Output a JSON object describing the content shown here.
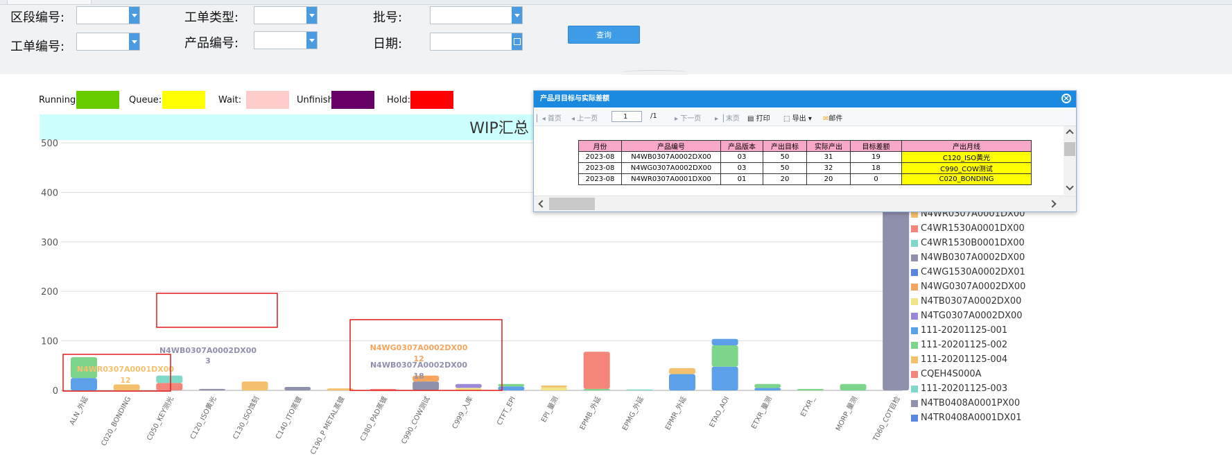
{
  "filters": {
    "section_no": {
      "label": "区段编号:",
      "value": ""
    },
    "order_type": {
      "label": "工单类型:",
      "value": ""
    },
    "batch_no": {
      "label": "批号:",
      "value": ""
    },
    "order_no": {
      "label": "工单编号:",
      "value": ""
    },
    "product_no": {
      "label": "产品编号:",
      "value": ""
    },
    "date": {
      "label": "日期:",
      "value": ""
    },
    "query_label": "查询"
  },
  "status_legend": [
    {
      "label": "Running:",
      "color": "#66cc00"
    },
    {
      "label": "Queue:",
      "color": "#ffff00"
    },
    {
      "label": "Wait:",
      "color": "#ffcccc"
    },
    {
      "label": "Unfinish:",
      "color": "#660066"
    },
    {
      "label": "Hold:",
      "color": "#ff0000"
    }
  ],
  "chart_data": {
    "type": "bar",
    "title": "WIP汇总",
    "ylim": [
      0,
      500
    ],
    "yticks": [
      0,
      100,
      200,
      300,
      400,
      500
    ],
    "grid": true,
    "legend_position": "right",
    "categories": [
      "ALN_外延",
      "C020_BONDING",
      "C050_KEY测光",
      "C120_ISO黄光",
      "C130_ISO蚀刻",
      "C140_ITO蒸镀",
      "C190_P METAL蒸镀",
      "C380_PAD蒸镀",
      "C990_COW测试",
      "C999_入库",
      "CTFT_EPI",
      "EPI_量测",
      "EPMB_外延",
      "EPMG_外延",
      "EPMR_外延",
      "ETAO_AOI",
      "ETXR_量测",
      "ETXR_",
      "MORP_量测",
      "T060_COT目检"
    ],
    "stacks": [
      [
        {
          "color": "#5ba0e8",
          "value": 25
        },
        {
          "color": "#7cd58a",
          "value": 42
        }
      ],
      [
        {
          "color": "#f5c06d",
          "value": 12
        }
      ],
      [
        {
          "color": "#f4857a",
          "value": 15
        },
        {
          "color": "#7ed9c9",
          "value": 15
        }
      ],
      [
        {
          "color": "#8f90ac",
          "value": 3
        }
      ],
      [
        {
          "color": "#f5c06d",
          "value": 18
        }
      ],
      [
        {
          "color": "#8f90ac",
          "value": 7
        }
      ],
      [
        {
          "color": "#f5c06d",
          "value": 4
        }
      ],
      [
        {
          "color": "#f4857a",
          "value": 3
        }
      ],
      [
        {
          "color": "#8f90ac",
          "value": 18
        },
        {
          "color": "#f5a55e",
          "value": 12
        }
      ],
      [
        {
          "color": "#f2e48a",
          "value": 5
        },
        {
          "color": "#9b88d8",
          "value": 8
        }
      ],
      [
        {
          "color": "#5ba0e8",
          "value": 8
        },
        {
          "color": "#7cd58a",
          "value": 5
        }
      ],
      [
        {
          "color": "#f2e48a",
          "value": 6
        },
        {
          "color": "#f5c06d",
          "value": 4
        }
      ],
      [
        {
          "color": "#7cd58a",
          "value": 3
        },
        {
          "color": "#f4857a",
          "value": 75
        }
      ],
      [
        {
          "color": "#7ed9c9",
          "value": 2
        }
      ],
      [
        {
          "color": "#5ba0e8",
          "value": 33
        },
        {
          "color": "#f5c06d",
          "value": 12
        }
      ],
      [
        {
          "color": "#5ba0e8",
          "value": 48
        },
        {
          "color": "#7cd58a",
          "value": 43
        },
        {
          "color": "#5ba0e8",
          "value": 13
        }
      ],
      [
        {
          "color": "#5ba0e8",
          "value": 5
        },
        {
          "color": "#7cd58a",
          "value": 8
        }
      ],
      [
        {
          "color": "#7cd58a",
          "value": 3
        }
      ],
      [
        {
          "color": "#7cd58a",
          "value": 13
        }
      ],
      [
        {
          "color": "#8f90ac",
          "value": 430
        }
      ]
    ],
    "annotations": [
      {
        "text": "N4WR0307A0001DX00",
        "value_text": "12",
        "color": "#f5c06d"
      },
      {
        "text": "N4WB0307A0002DX00",
        "value_text": "3",
        "color": "#8f90ac"
      },
      {
        "text": "N4WG0307A0002DX00",
        "value_text": "12",
        "color": "#f5a55e"
      },
      {
        "text": "N4WB0307A0002DX00",
        "value_text": "18",
        "color": "#8f90ac"
      }
    ],
    "series_legend": [
      {
        "name": "N4WR0307A0001DX00",
        "color": "#f5c06d"
      },
      {
        "name": "C4WR1530A0001DX00",
        "color": "#f4857a"
      },
      {
        "name": "C4WR1530B0001DX00",
        "color": "#7ed9c9"
      },
      {
        "name": "N4WB0307A0002DX00",
        "color": "#8f90ac"
      },
      {
        "name": "C4WG1530A0002DX01",
        "color": "#5b86e0"
      },
      {
        "name": "N4WG0307A0002DX00",
        "color": "#f5a55e"
      },
      {
        "name": "N4TB0307A0002DX00",
        "color": "#f2e48a"
      },
      {
        "name": "N4TG0307A0002DX00",
        "color": "#9b88d8"
      },
      {
        "name": "111-20201125-001",
        "color": "#5ba0e8"
      },
      {
        "name": "111-20201125-002",
        "color": "#7cd58a"
      },
      {
        "name": "111-20201125-004",
        "color": "#f5c06d"
      },
      {
        "name": "CQEH4S000A",
        "color": "#f4857a"
      },
      {
        "name": "111-20201125-003",
        "color": "#7ed9c9"
      },
      {
        "name": "N4TB0408A0001PX00",
        "color": "#8f90ac"
      },
      {
        "name": "N4TR0408A0001DX01",
        "color": "#5b86e0"
      }
    ]
  },
  "popup": {
    "title": "产品月目标与实际差额",
    "toolbar": {
      "first": "首页",
      "prev": "上一页",
      "page": "1",
      "total": "/1",
      "next": "下一页",
      "last": "末页",
      "print": "打印",
      "export": "导出",
      "mail": "邮件"
    },
    "headers": [
      "月份",
      "产品编号",
      "产品版本",
      "产出目标",
      "实际产出",
      "目标差额",
      "产出月线"
    ],
    "rows": [
      [
        "2023-08",
        "N4WB0307A0002DX00",
        "03",
        "50",
        "31",
        "19",
        "C120_ISO黄光"
      ],
      [
        "2023-08",
        "N4WG0307A0002DX00",
        "03",
        "50",
        "32",
        "18",
        "C990_COW测试"
      ],
      [
        "2023-08",
        "N4WR0307A0001DX00",
        "01",
        "20",
        "20",
        "0",
        "C020_BONDING"
      ]
    ]
  }
}
